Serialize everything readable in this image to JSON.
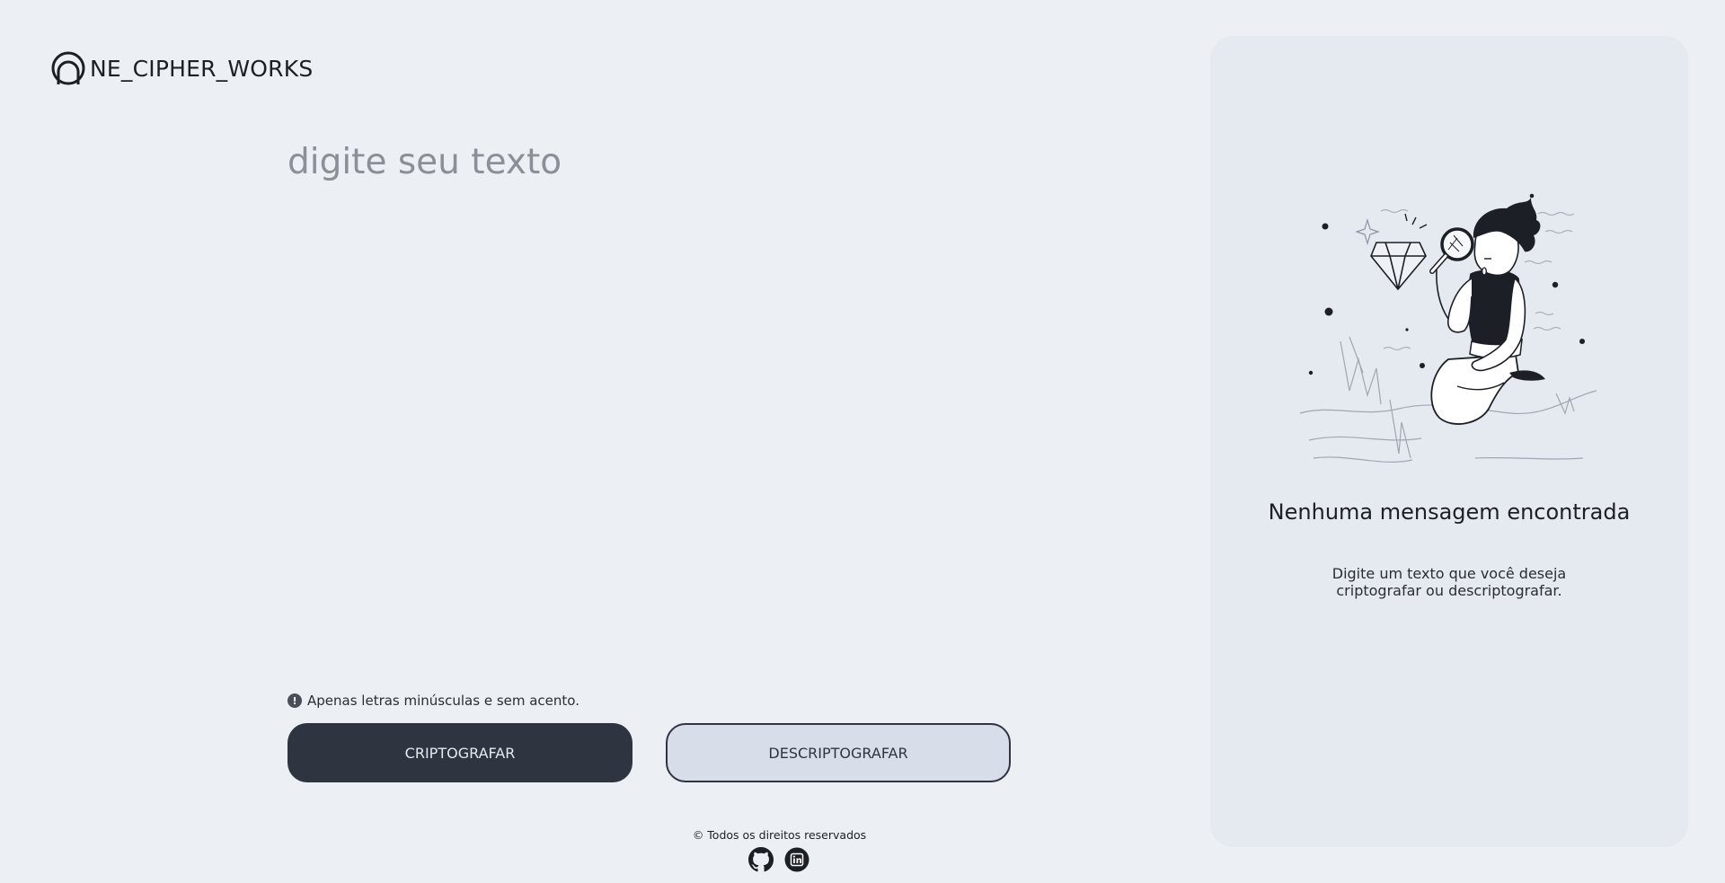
{
  "brand": {
    "name": "NE_CIPHER_WORKS",
    "icon": "ring-logo-icon"
  },
  "editor": {
    "placeholder": "digite seu texto",
    "value": ""
  },
  "hint": {
    "icon": "exclamation-circle-icon",
    "text": "Apenas letras minúsculas e sem acento."
  },
  "actions": {
    "encrypt_label": "CRIPTOGRAFAR",
    "decrypt_label": "DESCRIPTOGRAFAR"
  },
  "footer": {
    "copyright": "© Todos os direitos reservados",
    "links": [
      "github-icon",
      "linkedin-icon"
    ]
  },
  "result_panel": {
    "illustration": "person-with-magnifying-glass-illustration",
    "title": "Nenhuma mensagem encontrada",
    "subtitle": "Digite um texto que você deseja criptografar ou descriptografar."
  },
  "colors": {
    "background": "#eceff4",
    "panel": "#e5e9f0",
    "primary": "#2e3440",
    "secondary": "#d8dee9",
    "text": "#1c1f26"
  }
}
